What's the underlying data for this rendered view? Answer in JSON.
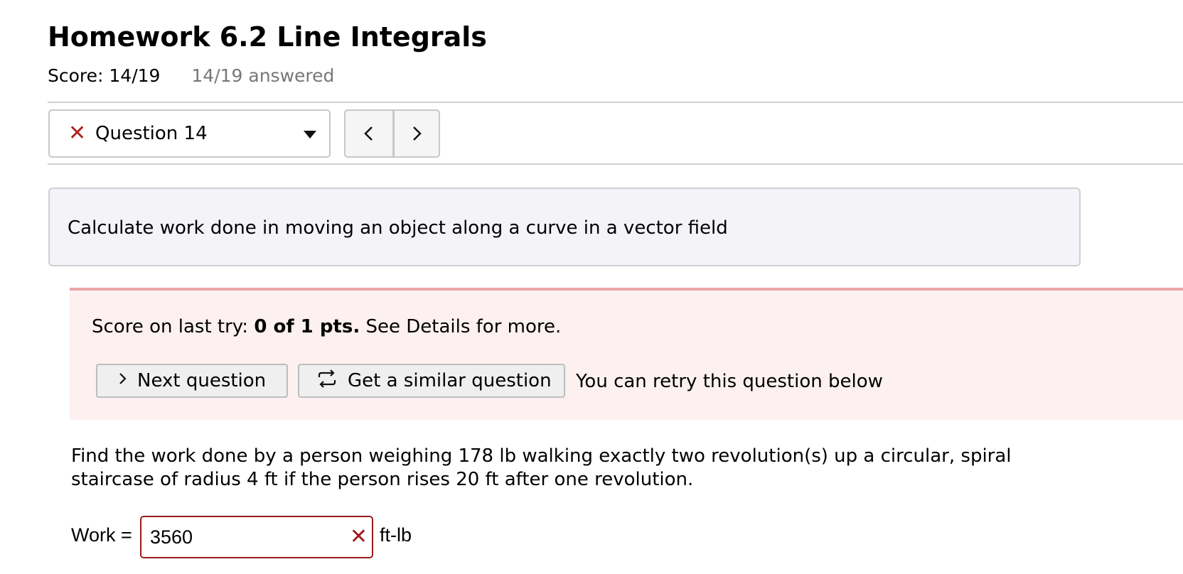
{
  "header": {
    "title": "Homework 6.2 Line Integrals",
    "score": "Score: 14/19",
    "answered": "14/19 answered"
  },
  "question_nav": {
    "status_icon": "x-icon",
    "selected": "Question 14",
    "prev_icon": "chevron-left-icon",
    "next_icon": "chevron-right-icon"
  },
  "topic": {
    "text": "Calculate work done in moving an object along a curve in a vector field"
  },
  "feedback": {
    "score_prefix": "Score on last try: ",
    "score_bold": "0 of 1 pts.",
    "score_suffix": " See Details for more.",
    "next_button": "Next question",
    "similar_button": "Get a similar question",
    "retry_text": "You can retry this question below",
    "colors": {
      "background": "#fdf0f0",
      "border": "#eba5a5"
    }
  },
  "problem": {
    "text": "Find the work done by a person weighing 178 lb walking exactly two revolution(s) up a circular, spiral staircase of radius 4 ft if the person rises 20 ft after one revolution."
  },
  "answer": {
    "label": "Work =",
    "value": "3560",
    "unit": "ft-lb",
    "status_icon": "incorrect-x-icon",
    "colors": {
      "incorrect": "#9b1c1c"
    }
  }
}
